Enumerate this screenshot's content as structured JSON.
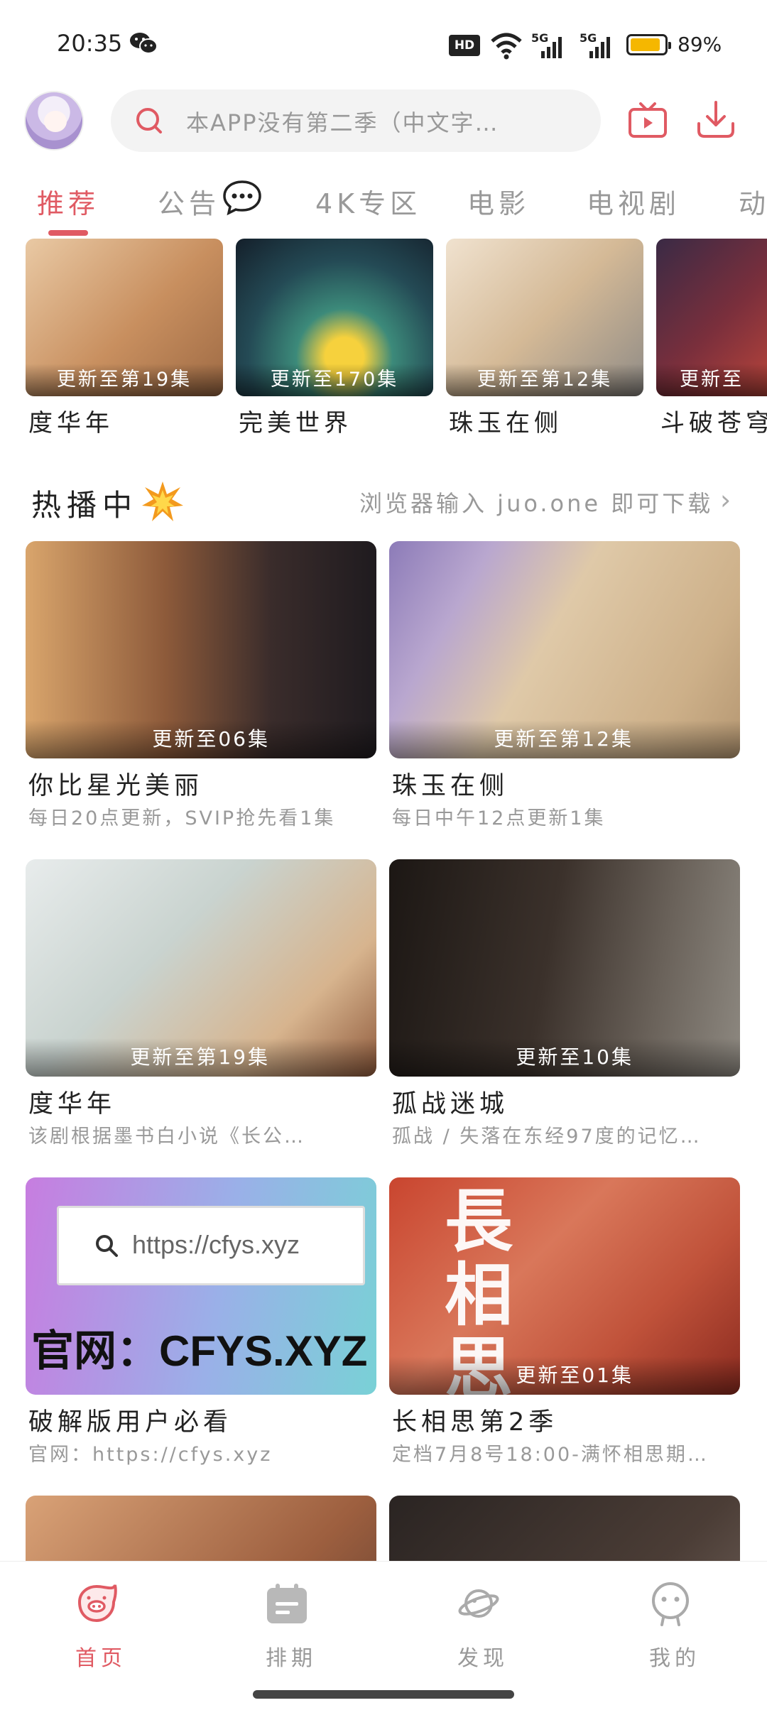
{
  "status_bar": {
    "time": "20:35",
    "hd_label": "HD",
    "network_1": "5G",
    "network_2": "5G",
    "battery_text": "89%",
    "battery_level_percent": 89,
    "icons": [
      "wechat-icon",
      "wifi-icon",
      "signal-icon",
      "battery-icon"
    ]
  },
  "search": {
    "placeholder": "本APP没有第二季（中文字…"
  },
  "tabs": [
    {
      "label": "推荐",
      "active": true
    },
    {
      "label": "公告"
    },
    {
      "label": "4K专区"
    },
    {
      "label": "电影"
    },
    {
      "label": "电视剧"
    },
    {
      "label": "动"
    }
  ],
  "top_row": [
    {
      "title": "度华年",
      "episode": "更新至第19集"
    },
    {
      "title": "完美世界",
      "episode": "更新至170集"
    },
    {
      "title": "珠玉在侧",
      "episode": "更新至第12集"
    },
    {
      "title": "斗破苍穹",
      "episode": "更新至"
    }
  ],
  "section": {
    "title": "热播中",
    "right_text": "浏览器输入 juo.one 即可下载"
  },
  "grid": [
    {
      "title": "你比星光美丽",
      "subtitle": "每日20点更新，SVIP抢先看1集",
      "episode": "更新至06集"
    },
    {
      "title": "珠玉在侧",
      "subtitle": "每日中午12点更新1集",
      "episode": "更新至第12集"
    },
    {
      "title": "度华年",
      "subtitle": "该剧根据墨书白小说《长公…",
      "episode": "更新至第19集"
    },
    {
      "title": "孤战迷城",
      "subtitle": "孤战 / 失落在东经97度的记忆…",
      "episode": "更新至10集"
    },
    {
      "title": "破解版用户必看",
      "subtitle": "官网：https://cfys.xyz",
      "episode": "",
      "banner_url": "https://cfys.xyz",
      "banner_big": "官网：CFYS.XYZ"
    },
    {
      "title": "长相思第2季",
      "subtitle": "定档7月8号18:00-满怀相思期…",
      "episode": "更新至01集",
      "poster_text": "長相思"
    }
  ],
  "bottom_nav": [
    {
      "label": "首页",
      "icon": "pig-home-icon",
      "active": true
    },
    {
      "label": "排期",
      "icon": "calendar-icon"
    },
    {
      "label": "发现",
      "icon": "planet-icon"
    },
    {
      "label": "我的",
      "icon": "profile-icon"
    }
  ],
  "colors": {
    "accent": "#e05a63",
    "battery": "#f5b700",
    "muted_text": "#999999"
  }
}
